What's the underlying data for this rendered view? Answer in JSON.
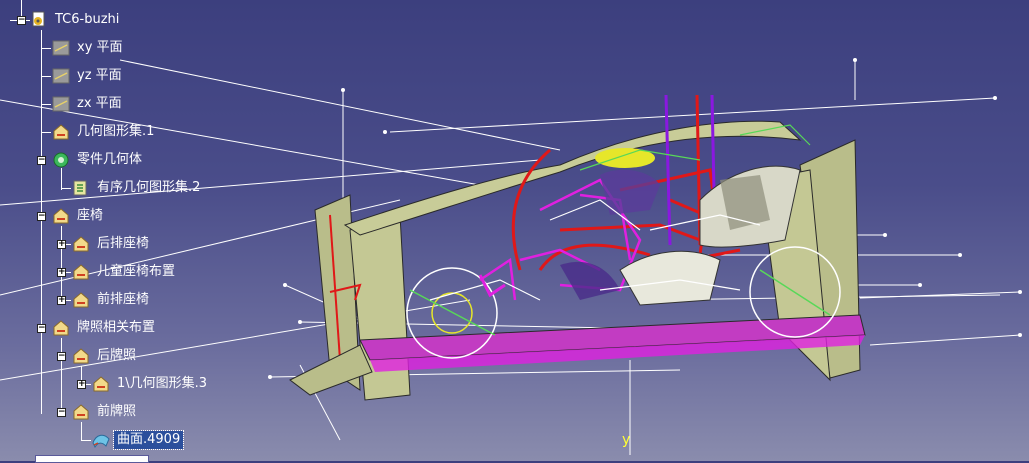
{
  "tree": {
    "root": "TC6-buzhi",
    "items": [
      {
        "label": "xy 平面",
        "icon": "plane-icon"
      },
      {
        "label": "yz 平面",
        "icon": "plane-icon"
      },
      {
        "label": "zx 平面",
        "icon": "plane-icon"
      },
      {
        "label": "几何图形集.1",
        "icon": "geometric-set-icon"
      },
      {
        "label": "零件几何体",
        "icon": "part-body-icon"
      },
      {
        "label": "有序几何图形集.2",
        "icon": "ordered-geometric-set-icon"
      },
      {
        "label": "座椅",
        "icon": "geometric-set-icon"
      },
      {
        "label": "后排座椅",
        "icon": "geometric-set-icon"
      },
      {
        "label": "儿童座椅布置",
        "icon": "geometric-set-icon"
      },
      {
        "label": "前排座椅",
        "icon": "geometric-set-icon"
      },
      {
        "label": "牌照相关布置",
        "icon": "geometric-set-icon"
      },
      {
        "label": "后牌照",
        "icon": "geometric-set-icon"
      },
      {
        "label": "1\\几何图形集.3",
        "icon": "geometric-set-icon"
      },
      {
        "label": "前牌照",
        "icon": "geometric-set-icon"
      },
      {
        "label": "曲面.4909",
        "icon": "surface-icon"
      }
    ]
  },
  "viewport": {
    "axis_label": "y",
    "colors": {
      "background_top": "#3c3f7e",
      "background_bottom": "#8a8cad",
      "body_panel": "#b9bd8a",
      "wire_red": "#e01818",
      "wire_magenta": "#e020e0",
      "wire_purple": "#8a18e0",
      "wire_white": "#ffffff",
      "wire_yellow": "#e6e62a",
      "wire_green": "#58d858"
    }
  }
}
